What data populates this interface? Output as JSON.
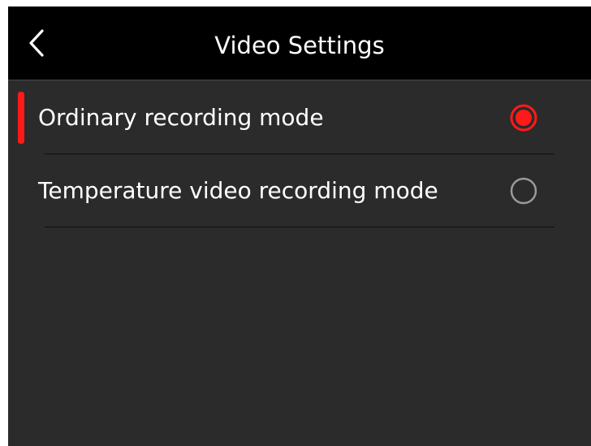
{
  "header": {
    "title": "Video Settings",
    "back_icon": "chevron-left-icon"
  },
  "options": [
    {
      "label": "Ordinary recording mode",
      "selected": true,
      "focused": true
    },
    {
      "label": "Temperature video recording mode",
      "selected": false,
      "focused": false
    }
  ],
  "colors": {
    "accent": "#ff1a1a",
    "header_background": "#000000",
    "screen_background": "#2b2b2b",
    "text": "#ffffff",
    "radio_unselected": "#9a9a9a"
  }
}
